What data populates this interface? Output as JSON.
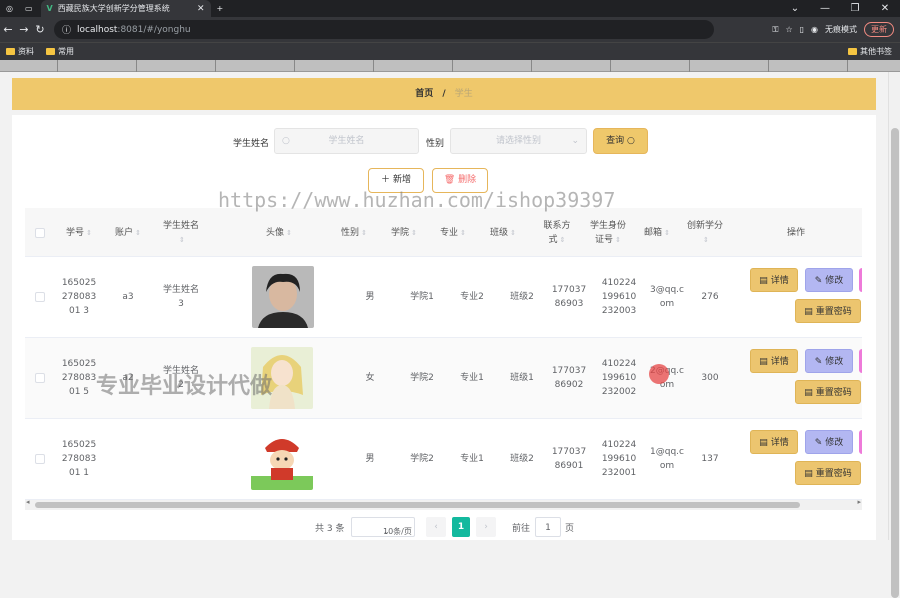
{
  "browser": {
    "tab_title": "西藏民族大学创新学分管理系统",
    "url_host": "localhost",
    "url_path": ":8081/#/yonghu",
    "incognito_label": "无痕模式",
    "update_label": "更新",
    "bookmarks": [
      "资料",
      "常用"
    ],
    "other_bookmarks": "其他书签"
  },
  "breadcrumb": {
    "home": "首页",
    "sep": "/",
    "current": "学生"
  },
  "search": {
    "name_label": "学生姓名",
    "name_placeholder": "学生姓名",
    "gender_label": "性别",
    "gender_placeholder": "请选择性别",
    "query_label": "查询"
  },
  "toolbar": {
    "add_label": "新增",
    "delete_label": "删除"
  },
  "table": {
    "headers": [
      "学号",
      "账户",
      "学生姓名",
      "头像",
      "性别",
      "学院",
      "专业",
      "班级",
      "联系方式",
      "学生身份证号",
      "邮箱",
      "创新学分",
      "操作"
    ],
    "rows": [
      {
        "id": "16502527808301 3",
        "account": "a3",
        "name": "学生姓名3",
        "gender": "男",
        "college": "学院1",
        "major": "专业2",
        "class": "班级2",
        "phone": "17703786903",
        "idcard": "410224199610232003",
        "email": "3@qq.com",
        "credits": "276"
      },
      {
        "id": "16502527808301 5",
        "account": "a2",
        "name": "学生姓名2",
        "gender": "女",
        "college": "学院2",
        "major": "专业1",
        "class": "班级1",
        "phone": "17703786902",
        "idcard": "410224199610232002",
        "email": "2@qq.com",
        "credits": "300"
      },
      {
        "id": "16502527808301 1",
        "account": "",
        "name": "",
        "gender": "男",
        "college": "学院2",
        "major": "专业1",
        "class": "班级2",
        "phone": "17703786901",
        "idcard": "410224199610232001",
        "email": "1@qq.com",
        "credits": "137"
      }
    ],
    "actions": {
      "detail": "详情",
      "edit": "修改",
      "reset_password": "重置密码"
    }
  },
  "pager": {
    "total": "共 3 条",
    "page_size": "10条/页",
    "current_page": "1",
    "goto_label": "前往",
    "goto_value": "1",
    "page_unit": "页"
  },
  "watermarks": {
    "url": "https://www.huzhan.com/ishop39397",
    "text": "专业毕业设计代做"
  }
}
